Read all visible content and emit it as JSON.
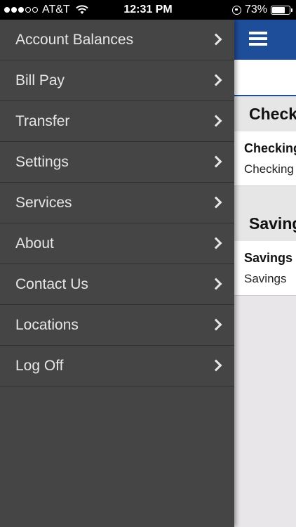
{
  "status_bar": {
    "carrier": "AT&T",
    "time": "12:31 PM",
    "battery": "73%",
    "battery_level": 0.73
  },
  "menu": {
    "items": [
      {
        "label": "Account Balances"
      },
      {
        "label": "Bill Pay"
      },
      {
        "label": "Transfer"
      },
      {
        "label": "Settings"
      },
      {
        "label": "Services"
      },
      {
        "label": "About"
      },
      {
        "label": "Contact Us"
      },
      {
        "label": "Locations"
      },
      {
        "label": "Log Off"
      }
    ]
  },
  "main": {
    "sections": [
      {
        "header": "Checking",
        "account_name": "Checking",
        "account_type": "Checking"
      },
      {
        "header": "Savings",
        "account_name": "Savings",
        "account_type": "Savings"
      }
    ]
  },
  "colors": {
    "menu_bg": "#454545",
    "nav_blue": "#1e4d9a",
    "menu_text": "#e6e6e6"
  }
}
